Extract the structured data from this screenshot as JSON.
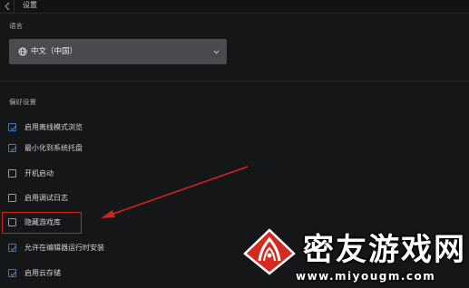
{
  "window": {
    "title": "设置"
  },
  "language": {
    "section_label": "语言",
    "selected": "中文（中国）"
  },
  "preferences": {
    "section_label": "偏好设置",
    "options": [
      {
        "label": "启用离线模式浏览",
        "checked": true
      },
      {
        "label": "最小化到系统托盘",
        "checked": true
      },
      {
        "label": "开机启动",
        "checked": false
      },
      {
        "label": "启用调试日志",
        "checked": false
      },
      {
        "label": "隐藏游戏库",
        "checked": false
      },
      {
        "label": "允许在编辑器运行时安装",
        "checked": true
      },
      {
        "label": "启用云存储",
        "checked": true
      }
    ]
  },
  "annotation": {
    "color": "#d0231c"
  },
  "watermark": {
    "brand": "密友游戏网",
    "url": "www.miyougm.com"
  },
  "colors": {
    "accent": "#3b78c4",
    "background": "#151618",
    "select_bg": "#4a4b4e"
  }
}
